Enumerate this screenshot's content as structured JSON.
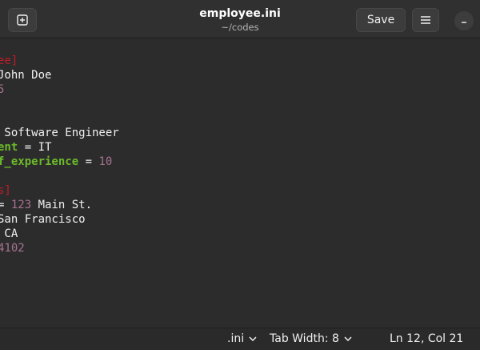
{
  "header": {
    "title": "employee.ini",
    "subtitle": "~/codes",
    "save_label": "Save",
    "icons": [
      "new-tab-icon",
      "hamburger-menu-icon",
      "minimize-icon"
    ]
  },
  "editor": {
    "lines": [
      [
        {
          "t": "ee]",
          "c": "sec"
        }
      ],
      [
        {
          "t": "John Doe",
          "c": ""
        }
      ],
      [
        {
          "t": "5",
          "c": "num"
        }
      ],
      [],
      [],
      [
        {
          "t": " Software Engineer",
          "c": ""
        }
      ],
      [
        {
          "t": "ent",
          "c": "key"
        },
        {
          "t": " = IT",
          "c": ""
        }
      ],
      [
        {
          "t": "f_experience",
          "c": "key"
        },
        {
          "t": " = ",
          "c": ""
        },
        {
          "t": "10",
          "c": "num"
        }
      ],
      [],
      [
        {
          "t": "s]",
          "c": "sec"
        }
      ],
      [
        {
          "t": "= ",
          "c": ""
        },
        {
          "t": "123",
          "c": "num"
        },
        {
          "t": " Main St.",
          "c": ""
        }
      ],
      [
        {
          "t": "San Francisco",
          "c": ""
        }
      ],
      [
        {
          "t": " CA",
          "c": ""
        }
      ],
      [
        {
          "t": "4102",
          "c": "num"
        }
      ]
    ]
  },
  "statusbar": {
    "language": ".ini",
    "tab_width": "Tab Width: 8",
    "cursor": "Ln 12, Col 21"
  },
  "colors": {
    "section": "#c01c28",
    "key": "#6cba2a",
    "number": "#a5738f",
    "background": "#2c2c2c"
  }
}
